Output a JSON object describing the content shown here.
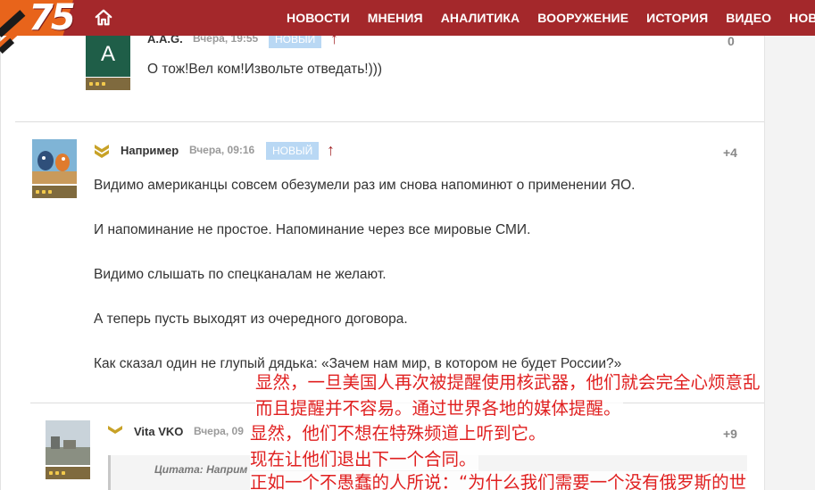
{
  "header": {
    "badge": "75",
    "nav": [
      "НОВОСТИ",
      "МНЕНИЯ",
      "АНАЛИТИКА",
      "ВООРУЖЕНИЕ",
      "ИСТОРИЯ",
      "ВИДЕО",
      "НОВОЕ"
    ]
  },
  "comments": [
    {
      "avatar_letter": "A",
      "author": "A.A.G.",
      "time": "Вчера, 19:55",
      "badge": "НОВЫЙ",
      "score": "0",
      "lines": [
        "О тож!Вел ком!Извольте отведать!)))"
      ]
    },
    {
      "author": "Например",
      "time": "Вчера, 09:16",
      "badge": "НОВЫЙ",
      "score": "+4",
      "lines": [
        "Видимо американцы совсем обезумели раз им снова напоминют о применении ЯО.",
        "И напоминание не простое. Напоминание через все мировые СМИ.",
        "Видимо слышать по спецканалам не желают.",
        "А теперь пусть выходят из очередного договора.",
        "Как сказал один не глупый дядька: «Зачем нам мир, в котором не будет России?»"
      ]
    },
    {
      "author": "Vita VKO",
      "time": "Вчера, 09",
      "score": "+9",
      "quote_label": "Цитата: Наприм"
    }
  ],
  "overlay": {
    "color": "#e02020",
    "lines": [
      "显然，一旦美国人再次被提醒使用核武器，他们就会完全心烦意乱",
      "而且提醒并不容易。通过世界各地的媒体提醒。",
      "显然，他们不想在特殊频道上听到它。",
      "现在让他们退出下一个合同。",
      "正如一个不愚蠢的人所说：“为什么我们需要一个没有俄罗斯的世"
    ]
  },
  "colors": {
    "nav_bg": "#a4282b",
    "badge_orange": "#e8641b",
    "new_badge": "#b9d8f4",
    "rank_bar": "#7f6a3e"
  }
}
